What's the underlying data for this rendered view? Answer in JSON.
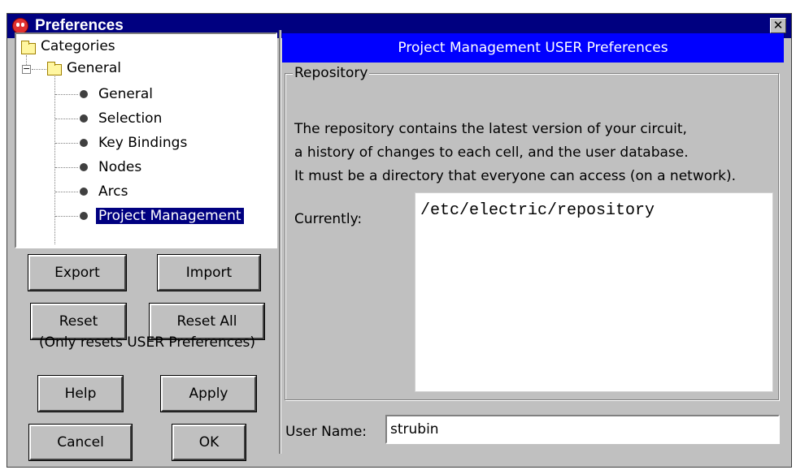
{
  "window": {
    "title": "Preferences",
    "close_glyph": "✕"
  },
  "tree": {
    "root": "Categories",
    "group": "General",
    "group_expander": "−",
    "items": [
      {
        "label": "General"
      },
      {
        "label": "Selection"
      },
      {
        "label": "Key Bindings"
      },
      {
        "label": "Nodes"
      },
      {
        "label": "Arcs"
      },
      {
        "label": "Project Management",
        "selected": true
      }
    ]
  },
  "buttons": {
    "export": "Export",
    "import": "Import",
    "reset": "Reset",
    "reset_all": "Reset All",
    "reset_note": "(Only resets USER Preferences)",
    "help": "Help",
    "apply": "Apply",
    "cancel": "Cancel",
    "ok": "OK"
  },
  "panel": {
    "header": "Project Management USER Preferences",
    "group_title": "Repository",
    "description": [
      "The repository contains the latest version of your circuit,",
      "a history of changes to each cell, and the user database.",
      "It must be a directory that everyone can access (on a network)."
    ],
    "currently_label": "Currently:",
    "repository_path": "/etc/electric/repository",
    "user_name_label": "User Name:",
    "user_name_value": "strubin"
  },
  "colors": {
    "title_bar": "#000080",
    "header_bar": "#0000ff",
    "selection": "#000080",
    "window_bg": "#c0c0c0"
  }
}
